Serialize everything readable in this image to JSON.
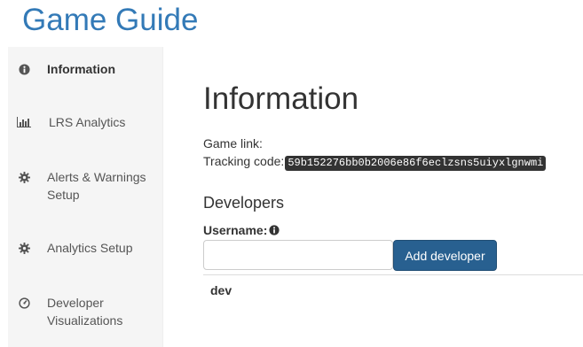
{
  "app": {
    "title": "Game Guide"
  },
  "sidebar": {
    "items": [
      {
        "label": "Information",
        "icon": "info-icon",
        "active": true
      },
      {
        "label": "LRS Analytics",
        "icon": "bar-chart-icon",
        "active": false
      },
      {
        "label": "Alerts & Warnings Setup",
        "icon": "gear-icon",
        "active": false
      },
      {
        "label": "Analytics Setup",
        "icon": "gear-icon",
        "active": false
      },
      {
        "label": "Developer Visualizations",
        "icon": "dashboard-icon",
        "active": false
      }
    ]
  },
  "main": {
    "title": "Information",
    "game_link_label": "Game link:",
    "game_link_value": "",
    "tracking_label": "Tracking code:",
    "tracking_code": "59b152276bb0b2006e86f6eclzsns5uiyxlgnwmi",
    "developers": {
      "title": "Developers",
      "username_label": "Username:",
      "username_value": "",
      "username_placeholder": "",
      "add_button": "Add developer",
      "list": [
        "dev"
      ]
    }
  },
  "colors": {
    "brand": "#337ab7",
    "primary_button": "#286090",
    "code_background": "#333333",
    "sidebar_background": "#f5f5f5"
  }
}
